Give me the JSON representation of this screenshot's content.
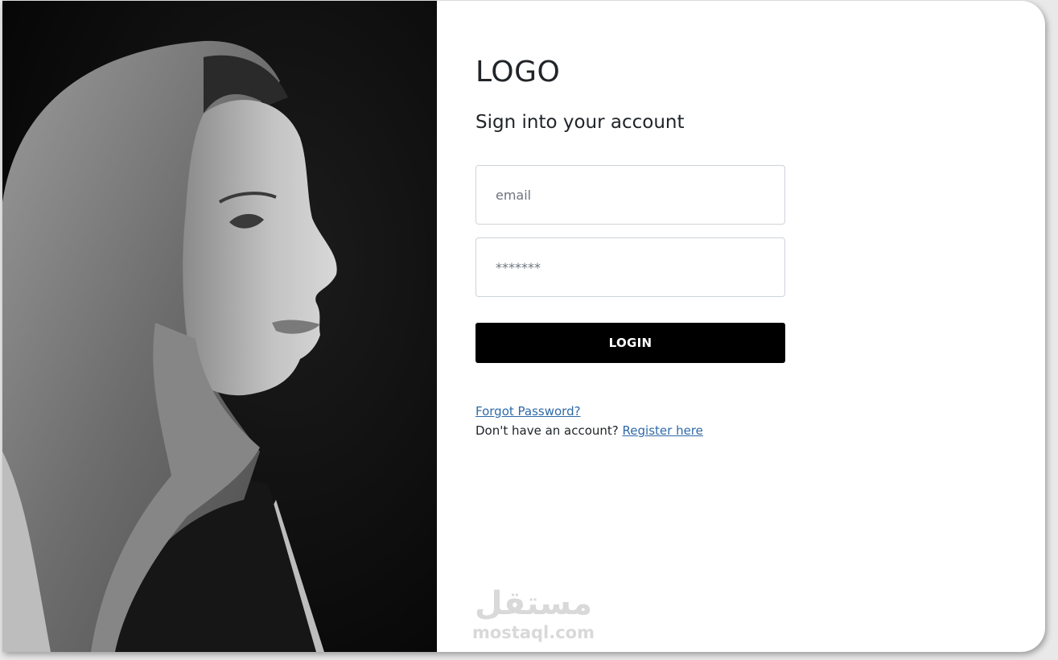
{
  "brand": {
    "logo_text": "LOGO",
    "heading": "Sign into your account"
  },
  "form": {
    "email_placeholder": "email",
    "password_placeholder": "*******",
    "login_label": "LOGIN",
    "forgot_label": "Forgot Password?",
    "no_account_text": "Don't have an account? ",
    "register_label": "Register here"
  },
  "watermark": {
    "arabic": "مستقل",
    "latin": "mostaql.com"
  },
  "image": {
    "subject": "black-and-white portrait of a woman in a headscarf, profile view"
  },
  "colors": {
    "button_bg": "#000000",
    "link": "#2f6aa8",
    "text": "#212529",
    "input_border": "#ced4da"
  }
}
